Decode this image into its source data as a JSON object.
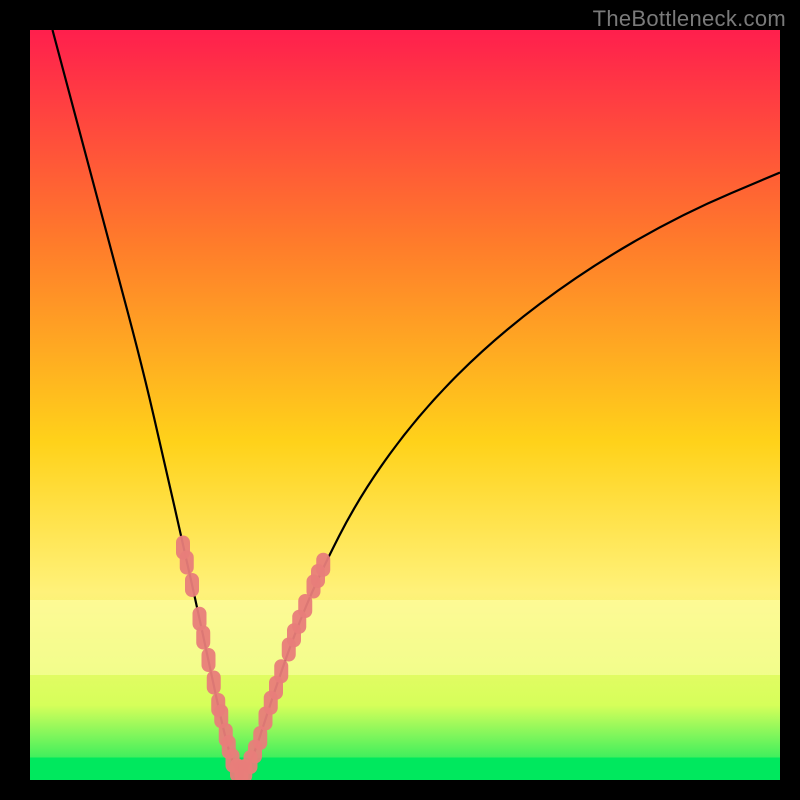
{
  "watermark": "TheBottleneck.com",
  "colors": {
    "frame": "#000000",
    "gradient_top": "#ff1f4d",
    "gradient_mid1": "#ff7a2b",
    "gradient_mid2": "#ffd21a",
    "gradient_mid3": "#fff27a",
    "gradient_band": "#d6ff5a",
    "gradient_bottom": "#00e85e",
    "curve": "#000000",
    "markers": "#e87d7a"
  },
  "chart_data": {
    "type": "line",
    "title": "",
    "xlabel": "",
    "ylabel": "",
    "xlim": [
      0,
      100
    ],
    "ylim": [
      0,
      100
    ],
    "curve": {
      "description": "V-shaped bottleneck curve; minimum near x≈27",
      "left_branch": [
        {
          "x": 3,
          "y": 100
        },
        {
          "x": 7,
          "y": 85
        },
        {
          "x": 11,
          "y": 70
        },
        {
          "x": 15,
          "y": 55
        },
        {
          "x": 18,
          "y": 42
        },
        {
          "x": 20.5,
          "y": 31
        },
        {
          "x": 22.5,
          "y": 22
        },
        {
          "x": 24.2,
          "y": 14
        },
        {
          "x": 25.5,
          "y": 8
        },
        {
          "x": 26.6,
          "y": 3.5
        },
        {
          "x": 27.6,
          "y": 1.2
        }
      ],
      "right_branch": [
        {
          "x": 28.7,
          "y": 1.2
        },
        {
          "x": 29.9,
          "y": 3.5
        },
        {
          "x": 31.2,
          "y": 7.5
        },
        {
          "x": 33.0,
          "y": 13
        },
        {
          "x": 35.3,
          "y": 19.5
        },
        {
          "x": 38.4,
          "y": 27
        },
        {
          "x": 44,
          "y": 38
        },
        {
          "x": 52,
          "y": 49
        },
        {
          "x": 62,
          "y": 59
        },
        {
          "x": 74,
          "y": 68
        },
        {
          "x": 87,
          "y": 75.5
        },
        {
          "x": 100,
          "y": 81
        }
      ]
    },
    "markers_left": [
      {
        "x": 20.4,
        "y": 31.0
      },
      {
        "x": 20.9,
        "y": 29.0
      },
      {
        "x": 21.6,
        "y": 26.0
      },
      {
        "x": 22.6,
        "y": 21.5
      },
      {
        "x": 23.1,
        "y": 19.0
      },
      {
        "x": 23.8,
        "y": 16.0
      },
      {
        "x": 24.5,
        "y": 13.0
      },
      {
        "x": 25.1,
        "y": 10.0
      },
      {
        "x": 25.5,
        "y": 8.5
      },
      {
        "x": 26.1,
        "y": 6.0
      },
      {
        "x": 26.5,
        "y": 4.4
      },
      {
        "x": 27.0,
        "y": 2.6
      },
      {
        "x": 27.6,
        "y": 1.3
      },
      {
        "x": 28.2,
        "y": 1.1
      },
      {
        "x": 28.7,
        "y": 1.2
      }
    ],
    "markers_right": [
      {
        "x": 29.4,
        "y": 2.4
      },
      {
        "x": 30.0,
        "y": 3.8
      },
      {
        "x": 30.7,
        "y": 5.6
      },
      {
        "x": 31.4,
        "y": 8.2
      },
      {
        "x": 32.1,
        "y": 10.3
      },
      {
        "x": 32.8,
        "y": 12.3
      },
      {
        "x": 33.5,
        "y": 14.5
      },
      {
        "x": 34.5,
        "y": 17.4
      },
      {
        "x": 35.2,
        "y": 19.3
      },
      {
        "x": 35.9,
        "y": 21.1
      },
      {
        "x": 36.7,
        "y": 23.2
      },
      {
        "x": 37.8,
        "y": 25.8
      },
      {
        "x": 38.4,
        "y": 27.2
      },
      {
        "x": 39.1,
        "y": 28.7
      }
    ]
  }
}
